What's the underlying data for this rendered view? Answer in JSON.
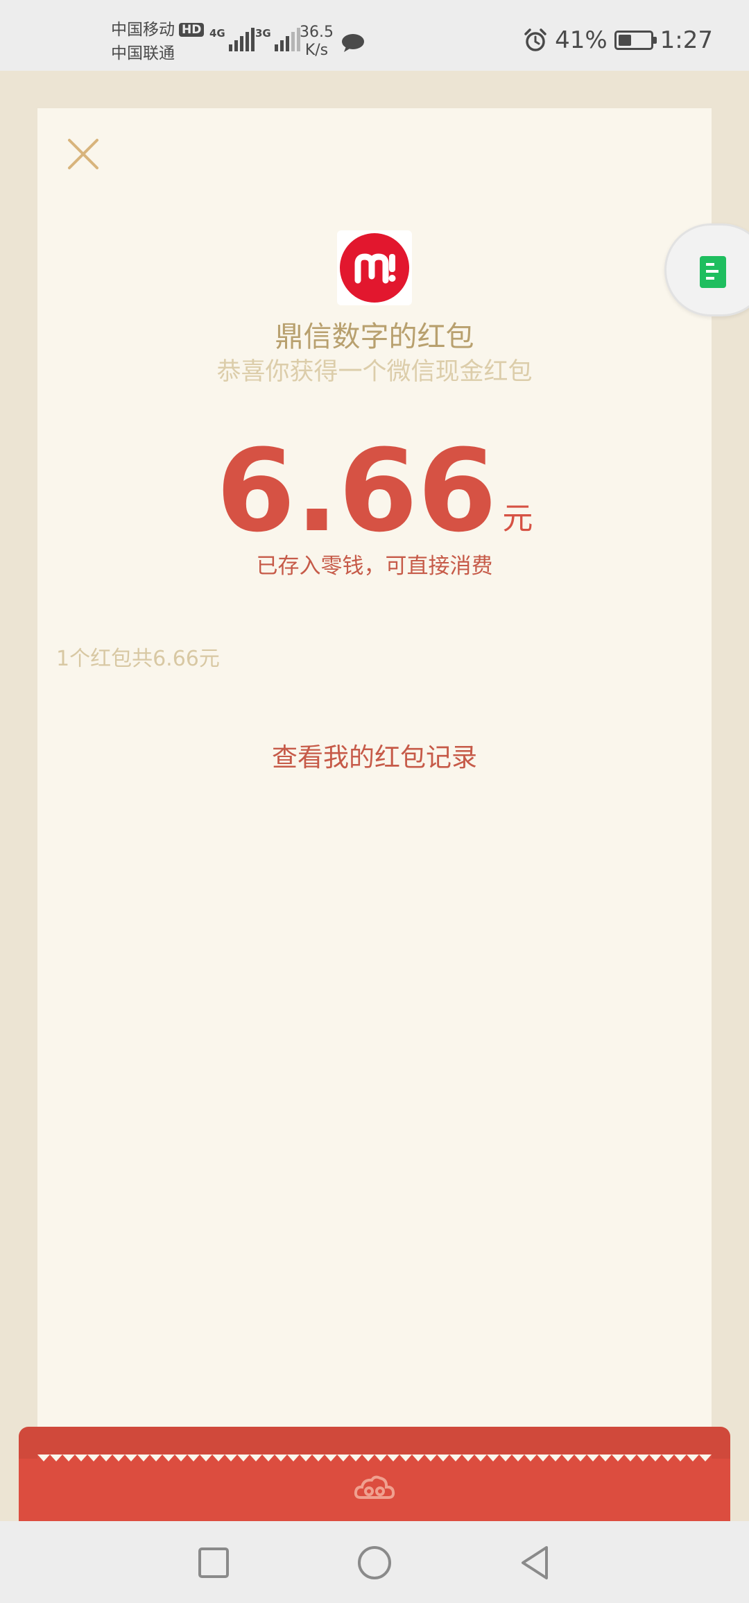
{
  "status_bar": {
    "carrier_1": "中国移动",
    "hd_badge": "HD",
    "carrier_2": "中国联通",
    "network_1": "4G",
    "network_2": "3G",
    "speed_value": "36.5",
    "speed_unit": "K/s",
    "battery_percent": "41%",
    "battery_level": 0.41,
    "time": "1:27",
    "icons": [
      "wechat-notification-icon",
      "alarm-icon",
      "battery-icon"
    ]
  },
  "card": {
    "close_icon": "close-icon",
    "logo_icon": "sender-logo",
    "sender_title": "鼎信数字的红包",
    "subtitle": "恭喜你获得一个微信现金红包",
    "amount": "6.66",
    "amount_unit": "元",
    "saved_note": "已存入零钱，可直接消费",
    "total_line": "1个红包共6.66元",
    "history_link": "查看我的红包记录"
  },
  "side_float": {
    "icon": "document-icon"
  },
  "envelope": {
    "emblem_icon": "cloud-emblem-icon"
  },
  "nav_bar": {
    "icons": [
      "recent-apps-icon",
      "home-icon",
      "back-icon"
    ]
  },
  "colors": {
    "accent_red": "#d65244",
    "gold_text": "#b8a06e",
    "card_bg": "#faf6ec",
    "page_bg": "#ece4d3",
    "envelope_red": "#dc4d3f",
    "float_green": "#1fbe5f"
  }
}
